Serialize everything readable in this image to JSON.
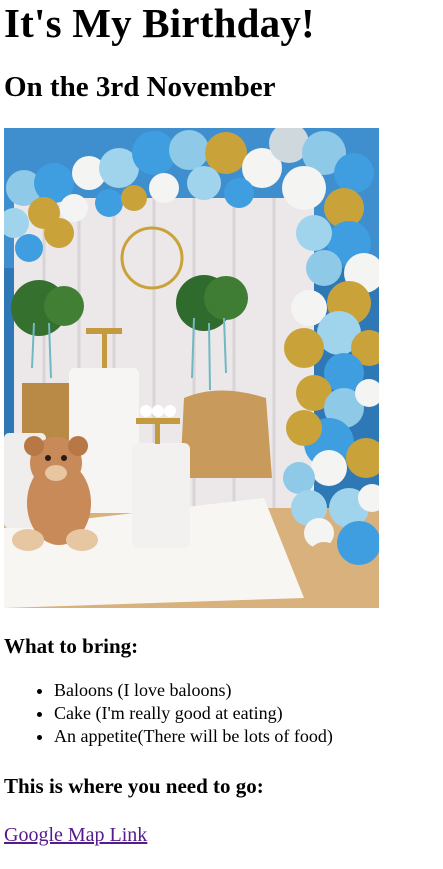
{
  "page": {
    "title": "It's My Birthday!",
    "subtitle": "On the 3rd November",
    "bring_heading": "What to bring:",
    "bring_items": [
      "Baloons (I love baloons)",
      "Cake (I'm really good at eating)",
      "An appetite(There will be lots of food)"
    ],
    "where_heading": "This is where you need to go:",
    "map_link_label": "Google Map Link"
  },
  "colors": {
    "link_visited": "#551a8b",
    "balloon_blue": "#3f9ee0",
    "balloon_light_blue": "#9fd4ec",
    "balloon_gold": "#c9a23a",
    "balloon_white": "#f4f4f2",
    "backdrop_wall": "#2f79b8",
    "curtain": "#ece9ea",
    "gold_cloth": "#c49a58",
    "rug": "#f7f5f2",
    "teddy": "#c98a5a"
  },
  "image": {
    "icon": "party-photo",
    "subject": "birthday party decoration with balloon arch, teddy bear and dessert table"
  }
}
